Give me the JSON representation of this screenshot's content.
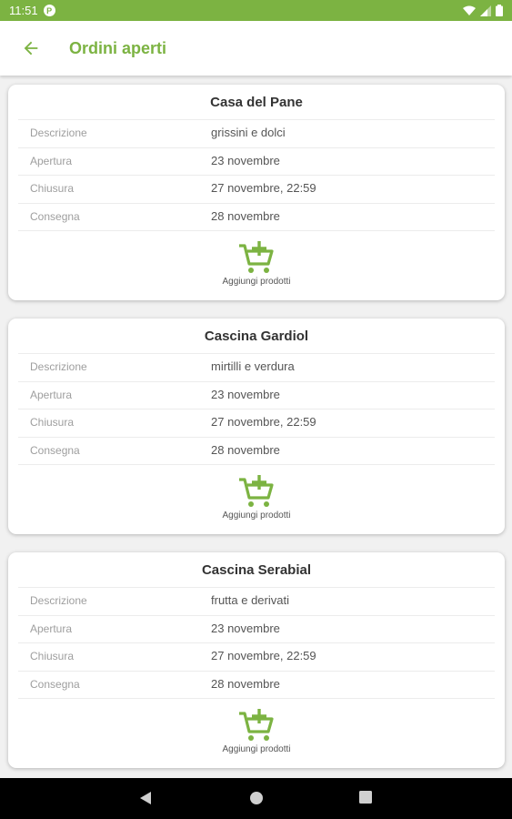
{
  "status_bar": {
    "time": "11:51",
    "notification_glyph": "P"
  },
  "app_bar": {
    "title": "Ordini aperti",
    "back_icon": "arrow-back-icon"
  },
  "colors": {
    "accent": "#7cb342",
    "card_bg": "#ffffff",
    "page_bg": "#f1f1f1"
  },
  "orders": [
    {
      "name": "Casa del Pane",
      "rows": [
        {
          "label": "Descrizione",
          "value": "grissini e dolci"
        },
        {
          "label": "Apertura",
          "value": "23 novembre"
        },
        {
          "label": "Chiusura",
          "value": "27 novembre, 22:59"
        },
        {
          "label": "Consegna",
          "value": "28 novembre"
        }
      ],
      "action_label": "Aggiungi prodotti",
      "action_icon": "add-to-cart-icon"
    },
    {
      "name": "Cascina Gardiol",
      "rows": [
        {
          "label": "Descrizione",
          "value": "mirtilli e verdura"
        },
        {
          "label": "Apertura",
          "value": "23 novembre"
        },
        {
          "label": "Chiusura",
          "value": "27 novembre, 22:59"
        },
        {
          "label": "Consegna",
          "value": "28 novembre"
        }
      ],
      "action_label": "Aggiungi prodotti",
      "action_icon": "add-to-cart-icon"
    },
    {
      "name": "Cascina Serabial",
      "rows": [
        {
          "label": "Descrizione",
          "value": "frutta e derivati"
        },
        {
          "label": "Apertura",
          "value": "23 novembre"
        },
        {
          "label": "Chiusura",
          "value": "27 novembre, 22:59"
        },
        {
          "label": "Consegna",
          "value": "28 novembre"
        }
      ],
      "action_label": "Aggiungi prodotti",
      "action_icon": "add-to-cart-icon"
    }
  ]
}
